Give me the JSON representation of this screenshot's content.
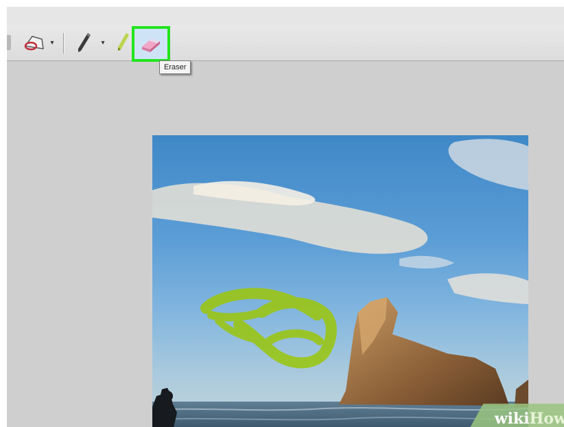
{
  "app": {
    "toolbar": {
      "tools": [
        {
          "name": "shape-tool",
          "icon": "shape-stamp-icon"
        },
        {
          "name": "pen-tool",
          "icon": "pen-icon"
        },
        {
          "name": "highlighter-tool",
          "icon": "highlighter-icon"
        },
        {
          "name": "eraser-tool",
          "icon": "eraser-icon",
          "selected": true
        }
      ],
      "dropdown_glyph": "▾"
    },
    "tooltip": "Eraser",
    "highlight_color": "#22e51e"
  },
  "watermark": {
    "part1": "wiki",
    "part2": "How"
  }
}
